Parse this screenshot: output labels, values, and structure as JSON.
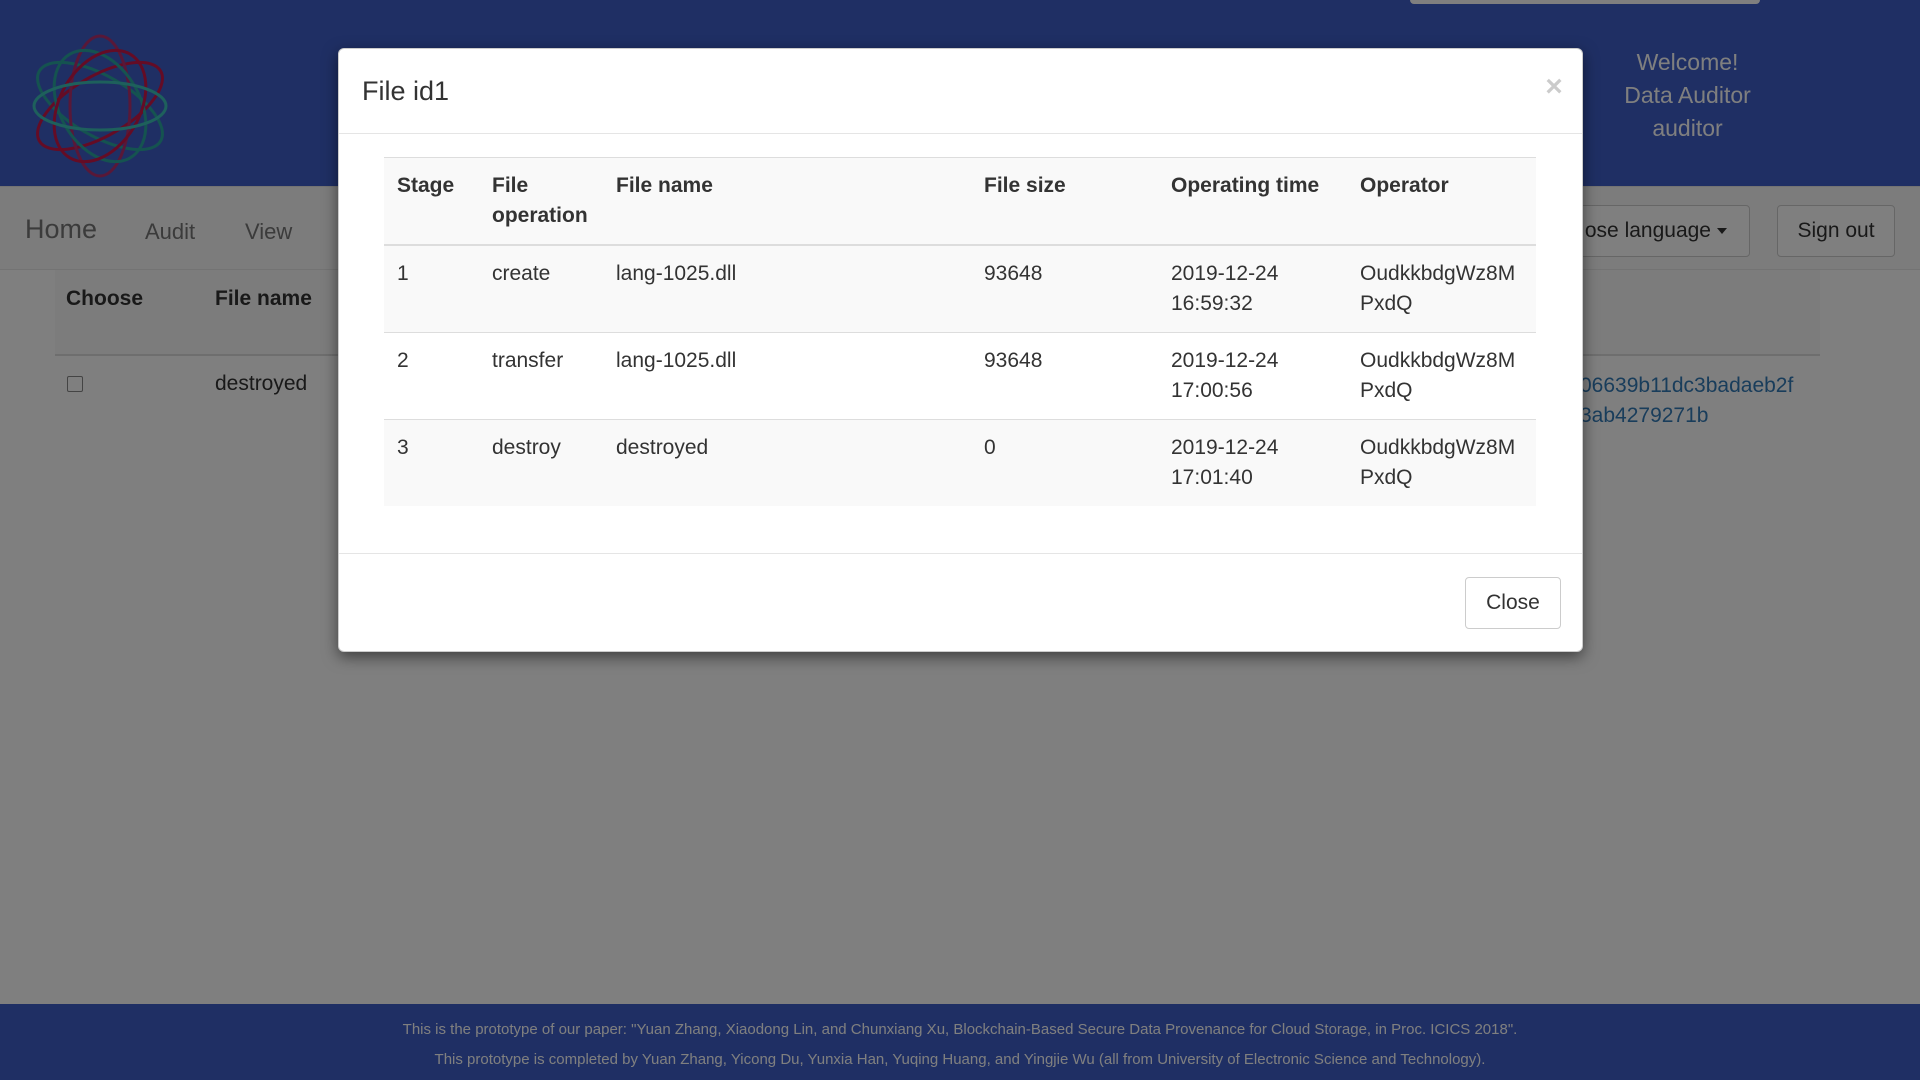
{
  "header": {
    "welcome_line1": "Welcome!",
    "welcome_line2": "Data Auditor",
    "welcome_line3": "auditor"
  },
  "navbar": {
    "brand": "Home",
    "audit": "Audit",
    "view": "View",
    "language_button": "ose language",
    "signout_button": "Sign out"
  },
  "background_table": {
    "headers": {
      "choose": "Choose",
      "file_name": "File name"
    },
    "row": {
      "file_name": "destroyed",
      "hash_line1": "06639b11dc3badaeb2f",
      "hash_line2": "3ab4279271b"
    }
  },
  "modal": {
    "title": "File id1",
    "close_x": "×",
    "columns": [
      "Stage",
      "File operation",
      "File name",
      "File size",
      "Operating time",
      "Operator"
    ],
    "rows": [
      {
        "stage": "1",
        "operation": "create",
        "file_name": "lang-1025.dll",
        "file_size": "93648",
        "time_date": "2019-12-24",
        "time_clock": "16:59:32",
        "operator_a": "OudkkbdgWz8M",
        "operator_b": "PxdQ"
      },
      {
        "stage": "2",
        "operation": "transfer",
        "file_name": "lang-1025.dll",
        "file_size": "93648",
        "time_date": "2019-12-24",
        "time_clock": "17:00:56",
        "operator_a": "OudkkbdgWz8M",
        "operator_b": "PxdQ"
      },
      {
        "stage": "3",
        "operation": "destroy",
        "file_name": "destroyed",
        "file_size": "0",
        "time_date": "2019-12-24",
        "time_clock": "17:01:40",
        "operator_a": "OudkkbdgWz8M",
        "operator_b": "PxdQ"
      }
    ],
    "close_button": "Close"
  },
  "footer": {
    "line1": "This is the prototype of our paper: \"Yuan Zhang, Xiaodong Lin, and Chunxiang Xu, Blockchain-Based Secure Data Provenance for Cloud Storage, in Proc. ICICS 2018\".",
    "line2": "This prototype is completed by Yuan Zhang, Yicong Du, Yunxia Han, Yuqing Huang, and Yingjie Wu (all from University of Electronic Science and Technology)."
  },
  "colors": {
    "header_bg": "#3f5fc9",
    "link": "#337ab7",
    "logo_red": "#c8184a",
    "logo_teal": "#2aa6a0"
  }
}
